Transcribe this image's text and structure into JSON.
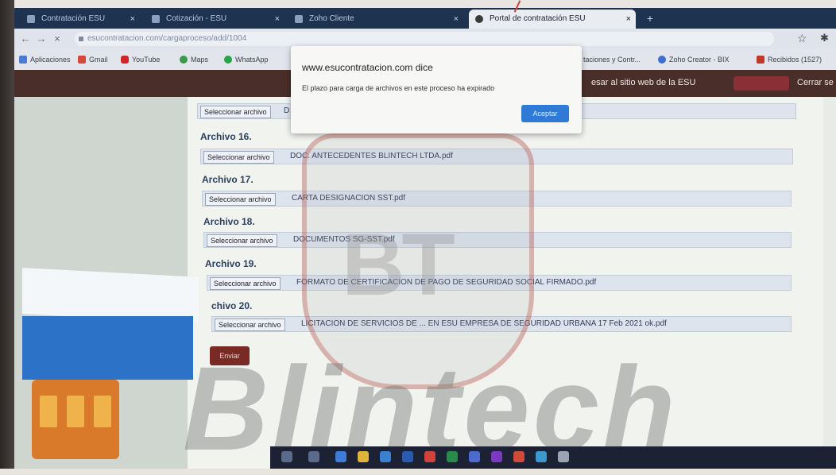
{
  "browser": {
    "tabs": [
      {
        "label": "Contratación ESU"
      },
      {
        "label": "Cotización - ESU"
      },
      {
        "label": "Zoho Cliente"
      },
      {
        "label": "Portal de contratación ESU"
      }
    ],
    "url": "esucontratacion.com/cargaproceso/add/1004",
    "bookmarks": [
      {
        "label": "Aplicaciones"
      },
      {
        "label": "Gmail"
      },
      {
        "label": "YouTube"
      },
      {
        "label": "Maps"
      },
      {
        "label": "WhatsApp"
      },
      {
        "label": "taciones y Contr..."
      },
      {
        "label": "Zoho Creator - BIX"
      },
      {
        "label": "Recibidos (1527)"
      }
    ]
  },
  "site_header": {
    "back_link": "esar al sitio web de la ESU",
    "logout": "Cerrar se"
  },
  "form": {
    "rows": [
      {
        "label": "",
        "button": "Seleccionar archivo",
        "filename": "D"
      },
      {
        "label": "Archivo 16.",
        "button": "Seleccionar archivo",
        "filename": "DOC. ANTECEDENTES BLINTECH LTDA.pdf"
      },
      {
        "label": "Archivo 17.",
        "button": "Seleccionar archivo",
        "filename": "CARTA DESIGNACION SST.pdf"
      },
      {
        "label": "Archivo 18.",
        "button": "Seleccionar archivo",
        "filename": "DOCUMENTOS SG-SST.pdf"
      },
      {
        "label": "Archivo 19.",
        "button": "Seleccionar archivo",
        "filename": "FORMATO DE CERTIFICACION DE PAGO DE SEGURIDAD SOCIAL FIRMADO.pdf"
      },
      {
        "label": "chivo 20.",
        "button": "Seleccionar archivo",
        "filename": "LICITACION DE SERVICIOS DE ... EN ESU EMPRESA DE SEGURIDAD URBANA 17 Feb 2021 ok.pdf"
      }
    ],
    "submit": "Enviar"
  },
  "dialog": {
    "title": "www.esucontratacion.com dice",
    "message": "El plazo para carga de archivos en este proceso ha expirado",
    "ok": "Aceptar"
  },
  "watermark": {
    "text": "Blintech",
    "shield_text": "BT"
  },
  "colors": {
    "header": "#4a2e2a",
    "accent": "#2f7ad6",
    "submit": "#7a2a24",
    "tabstrip": "#1e3350"
  }
}
